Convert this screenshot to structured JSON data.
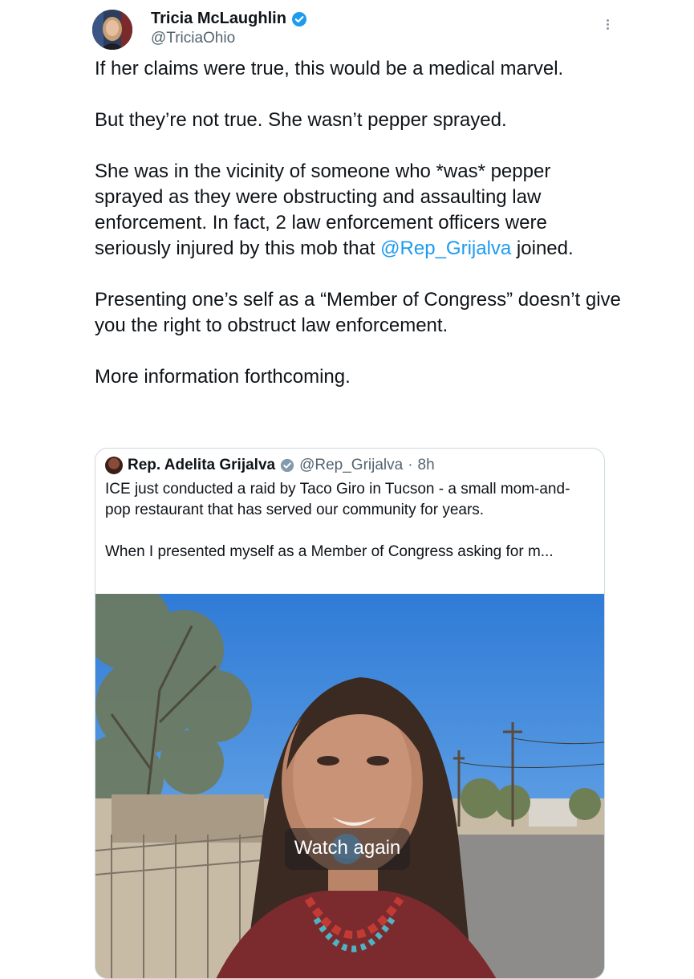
{
  "author": {
    "display_name": "Tricia McLaughlin",
    "handle": "@TriciaOhio",
    "verified_color": "#1d9bf0"
  },
  "tweet": {
    "p1": "If her claims were true, this would be a medical marvel.",
    "p2": "But they’re not true. She wasn’t pepper sprayed.",
    "p3a": "She was in the vicinity of someone who *was* pepper sprayed as they were obstructing and assaulting law enforcement. In fact, 2 law enforcement officers were seriously injured by this mob that ",
    "p3_mention": "@Rep_Grijalva",
    "p3b": " joined.",
    "p4": "Presenting one’s self as a “Member of Congress” doesn’t give you the right to obstruct law enforcement.",
    "p5": "More information forthcoming."
  },
  "quote": {
    "name": "Rep. Adelita Grijalva",
    "handle": "@Rep_Grijalva",
    "separator": "·",
    "time": "8h",
    "text1": "ICE just conducted a raid by Taco Giro in Tucson - a small mom-and-pop restaurant that has served our community for years.",
    "text2": "When I presented myself as a Member of Congress asking for m...",
    "media": {
      "overlay_label": "Watch again",
      "overlay_icon": "replay-icon"
    }
  },
  "colors": {
    "mention": "#1d9bf0",
    "secondary_text": "#536471",
    "border": "#cfd9de"
  }
}
